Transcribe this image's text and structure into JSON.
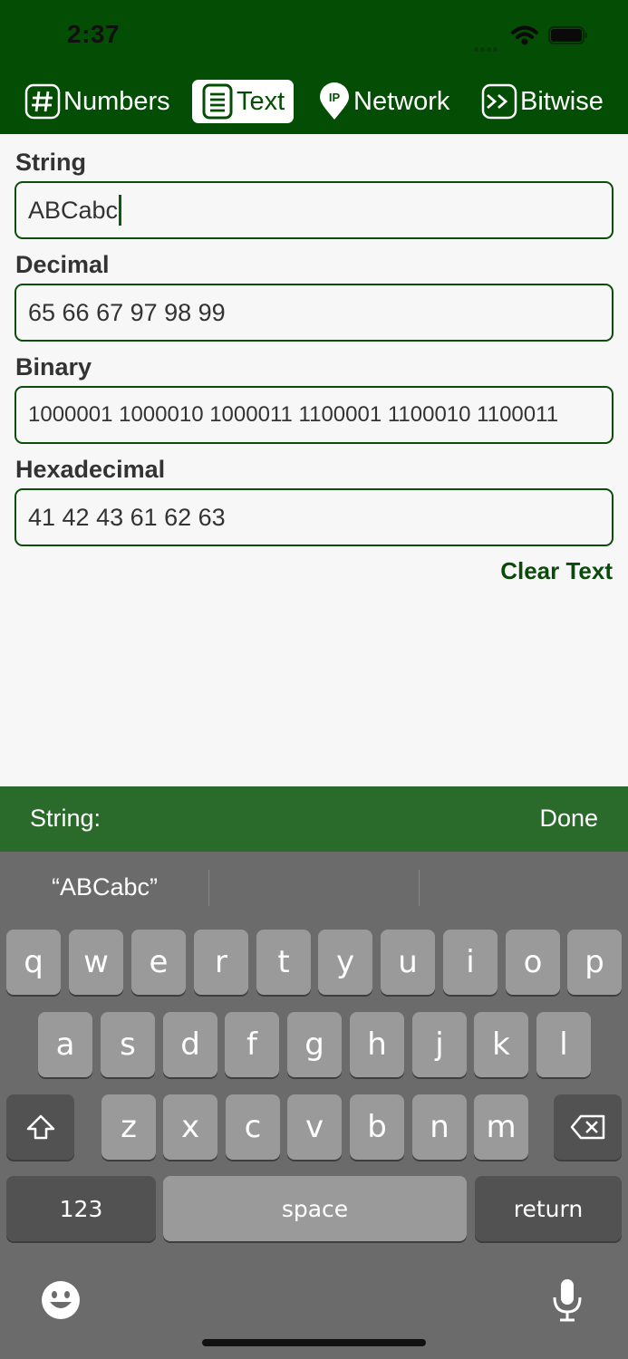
{
  "status_bar": {
    "time": "2:37"
  },
  "tabs": [
    {
      "label": "Numbers",
      "icon": "hash-icon"
    },
    {
      "label": "Text",
      "icon": "document-icon",
      "selected": true
    },
    {
      "label": "Network",
      "icon": "ip-pin-icon"
    },
    {
      "label": "Bitwise",
      "icon": "shift-icon"
    }
  ],
  "fields": {
    "string": {
      "label": "String",
      "value": "ABCabc"
    },
    "decimal": {
      "label": "Decimal",
      "value": "65 66 67 97 98 99"
    },
    "binary": {
      "label": "Binary",
      "value": "1000001 1000010 1000011 1100001 1100010 1100011"
    },
    "hexadecimal": {
      "label": "Hexadecimal",
      "value": "41 42 43 61 62 63"
    }
  },
  "clear_label": "Clear Text",
  "accessory": {
    "label": "String:",
    "done_label": "Done"
  },
  "keyboard": {
    "suggestion": "“ABCabc”",
    "row1": [
      "q",
      "w",
      "e",
      "r",
      "t",
      "y",
      "u",
      "i",
      "o",
      "p"
    ],
    "row2": [
      "a",
      "s",
      "d",
      "f",
      "g",
      "h",
      "j",
      "k",
      "l"
    ],
    "row3": [
      "z",
      "x",
      "c",
      "v",
      "b",
      "n",
      "m"
    ],
    "numbers_label": "123",
    "space_label": "space",
    "return_label": "return"
  },
  "colors": {
    "header": "#044d04",
    "accent": "#0b4a0b",
    "accessory": "#2a6a2a",
    "keyboard": "#6b6b6b"
  }
}
